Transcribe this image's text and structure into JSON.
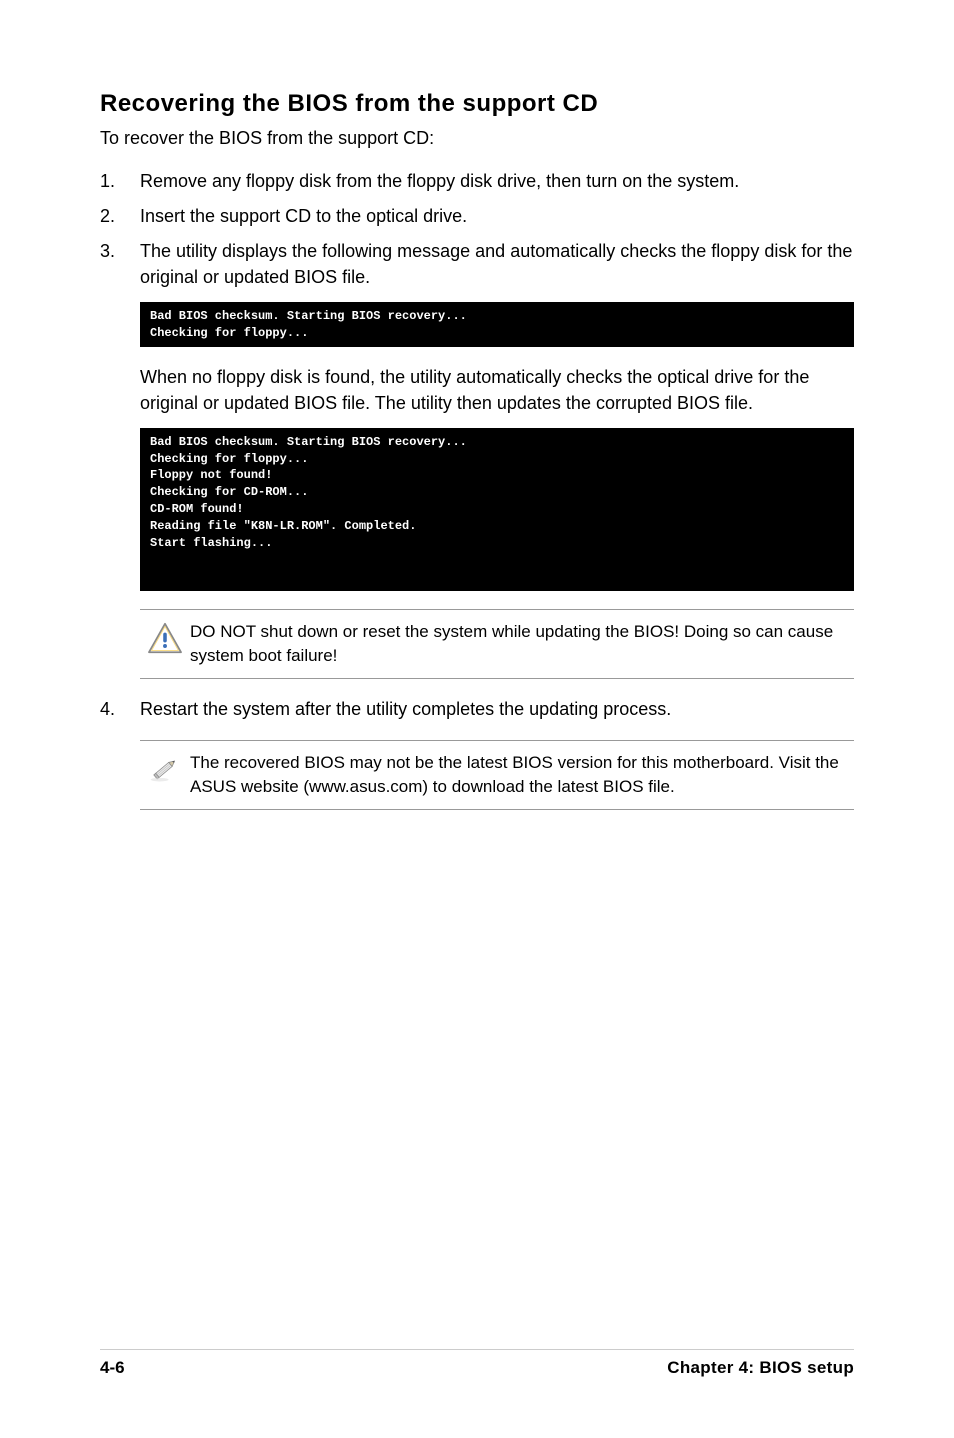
{
  "section": {
    "title": "Recovering the BIOS from the support CD",
    "intro": "To recover the BIOS from the support CD:"
  },
  "steps": {
    "s1": {
      "num": "1.",
      "text": "Remove any floppy disk from the floppy disk drive, then turn on the system."
    },
    "s2": {
      "num": "2.",
      "text": "Insert the support CD to the optical drive."
    },
    "s3": {
      "num": "3.",
      "text": "The utility displays the following message and automatically checks the floppy disk for the original or updated BIOS file."
    },
    "s4": {
      "num": "4.",
      "text": "Restart the system after the utility completes the updating process."
    }
  },
  "code": {
    "block1": "Bad BIOS checksum. Starting BIOS recovery...\nChecking for floppy...",
    "block2": "Bad BIOS checksum. Starting BIOS recovery...\nChecking for floppy...\nFloppy not found!\nChecking for CD-ROM...\nCD-ROM found!\nReading file \"K8N-LR.ROM\". Completed.\nStart flashing..."
  },
  "para": {
    "after_block1": "When no floppy disk is found, the utility automatically checks the optical drive for the original or updated BIOS file. The utility then updates the corrupted BIOS file."
  },
  "callouts": {
    "warning": "DO NOT shut down or reset the system while updating the BIOS! Doing so can cause system boot failure!",
    "note": "The recovered BIOS may not be the latest BIOS version for this motherboard. Visit the ASUS website (www.asus.com) to download the latest BIOS file."
  },
  "footer": {
    "left": "4-6",
    "right": "Chapter 4: BIOS setup"
  }
}
